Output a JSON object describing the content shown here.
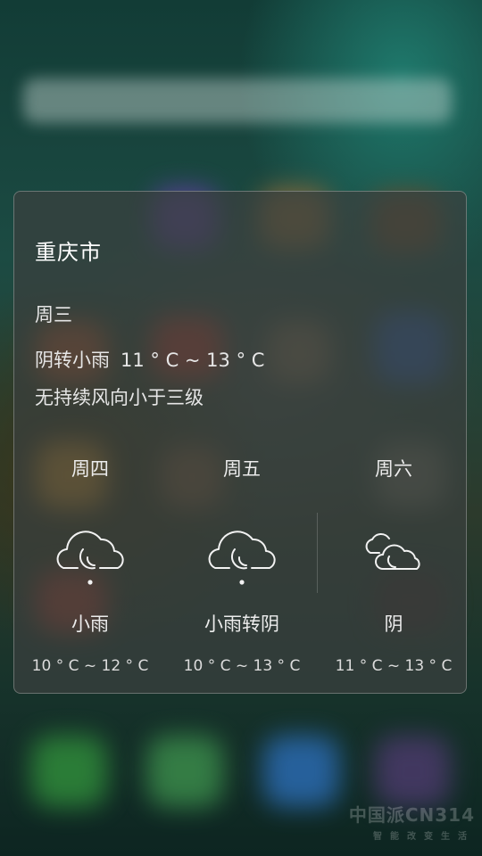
{
  "weather_card": {
    "city": "重庆市",
    "today": {
      "day": "周三",
      "condition": "阴转小雨",
      "temperature": "11 ° C ~ 13 ° C",
      "wind": "无持续风向小于三级"
    },
    "forecast": [
      {
        "day": "周四",
        "icon": "rain-cloud-icon",
        "condition": "小雨",
        "temperature": "10 ° C ~ 12 ° C"
      },
      {
        "day": "周五",
        "icon": "rain-cloud-icon",
        "condition": "小雨转阴",
        "temperature": "10 ° C ~ 13 ° C"
      },
      {
        "day": "周六",
        "icon": "overcast-clouds-icon",
        "condition": "阴",
        "temperature": "11 ° C ~ 13 ° C"
      }
    ]
  },
  "watermark": {
    "main": "中国派CN314",
    "sub": "智能改变生活"
  }
}
